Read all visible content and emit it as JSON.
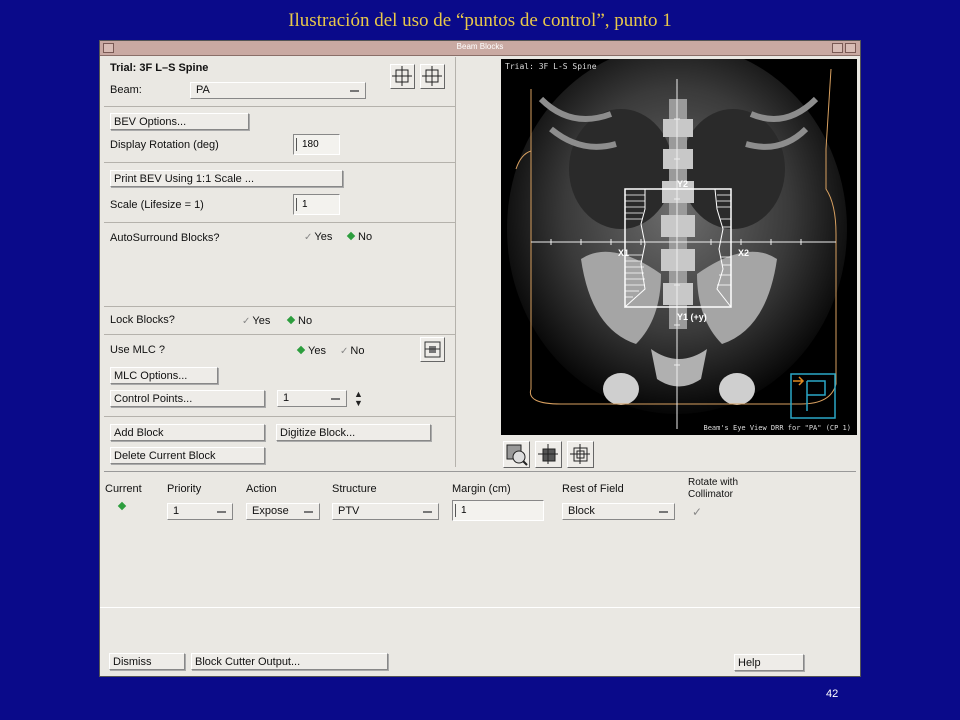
{
  "slide": {
    "title": "Ilustración del uso de “puntos de control”, punto 1",
    "page_number": "42"
  },
  "window": {
    "title": "Beam Blocks"
  },
  "left_panel": {
    "trial_label": "Trial: 3F L–S Spine",
    "beam_label": "Beam:",
    "beam_value": "PA",
    "bev_options": "BEV Options...",
    "display_rotation_label": "Display Rotation (deg)",
    "display_rotation_value": "180",
    "print_bev": "Print BEV Using 1:1 Scale ...",
    "scale_label": "Scale (Lifesize = 1)",
    "scale_value": "1",
    "autosurround_label": "AutoSurround Blocks?",
    "yes": "Yes",
    "no": "No",
    "lock_blocks_label": "Lock Blocks?",
    "use_mlc_label": "Use MLC ?",
    "mlc_options": "MLC Options...",
    "control_points": "Control Points...",
    "control_point_value": "1",
    "add_block": "Add Block",
    "digitize_block": "Digitize Block...",
    "delete_block": "Delete Current Block"
  },
  "viewer": {
    "trial_caption": "Trial: 3F L-S Spine",
    "bottom_caption": "Beam's Eye View DRR for \"PA\" (CP 1)",
    "jaw_labels": {
      "y2": "Y2",
      "x1": "X1",
      "x2": "X2",
      "y1": "Y1 (+y)"
    }
  },
  "block_table": {
    "headers": {
      "current": "Current",
      "priority": "Priority",
      "action": "Action",
      "structure": "Structure",
      "margin": "Margin (cm)",
      "rest": "Rest of Field",
      "rotate": "Rotate with Collimator"
    },
    "row": {
      "priority": "1",
      "action": "Expose",
      "structure": "PTV",
      "margin": "1",
      "rest": "Block"
    }
  },
  "footer": {
    "dismiss": "Dismiss",
    "block_cutter": "Block Cutter Output...",
    "help": "Help"
  },
  "colors": {
    "slide_bg": "#0a0a8a",
    "title": "#e8c84a",
    "radio_on": "#2d9e3e",
    "contour": "#d8a060"
  }
}
